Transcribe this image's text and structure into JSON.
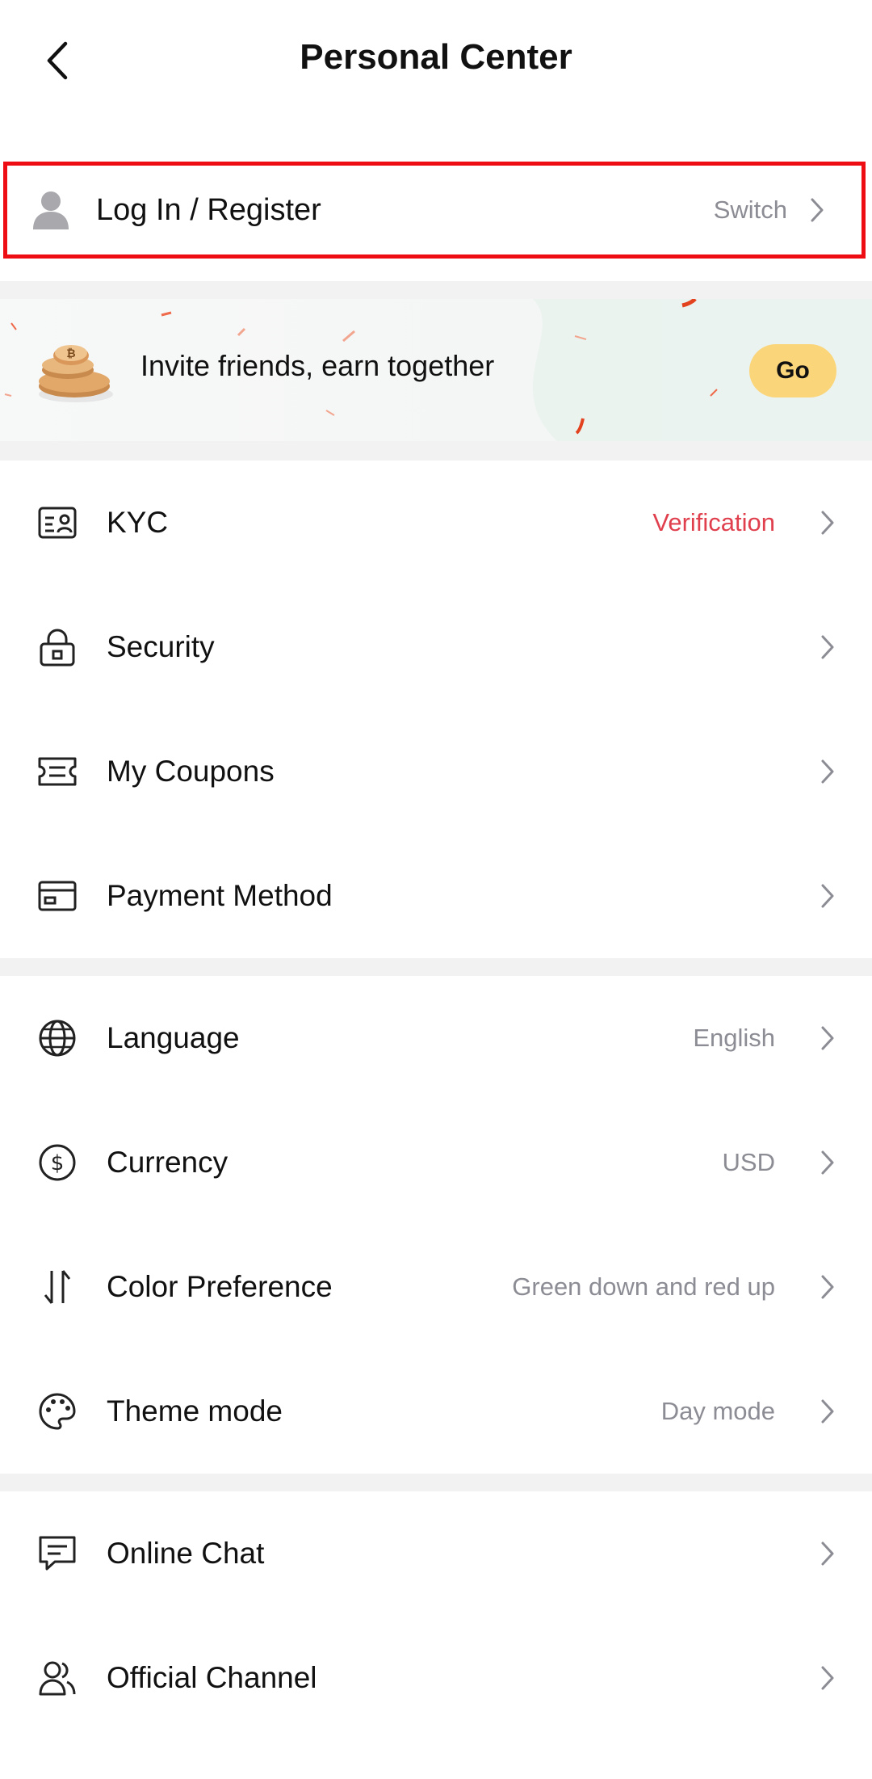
{
  "header": {
    "title": "Personal Center"
  },
  "account": {
    "login_label": "Log In / Register",
    "switch_label": "Switch"
  },
  "banner": {
    "text": "Invite friends, earn together",
    "button_label": "Go"
  },
  "menu": {
    "kyc": {
      "label": "KYC",
      "value": "Verification",
      "icon": "id-card-icon"
    },
    "security": {
      "label": "Security",
      "icon": "lock-icon"
    },
    "coupons": {
      "label": "My Coupons",
      "icon": "ticket-icon"
    },
    "payment": {
      "label": "Payment Method",
      "icon": "card-icon"
    },
    "language": {
      "label": "Language",
      "value": "English",
      "icon": "globe-icon"
    },
    "currency": {
      "label": "Currency",
      "value": "USD",
      "icon": "dollar-icon"
    },
    "color_pref": {
      "label": "Color Preference",
      "value": "Green down and red up",
      "icon": "arrows-updown-icon"
    },
    "theme": {
      "label": "Theme mode",
      "value": "Day mode",
      "icon": "palette-icon"
    },
    "chat": {
      "label": "Online Chat",
      "icon": "chat-icon"
    },
    "channel": {
      "label": "Official Channel",
      "icon": "users-icon"
    }
  },
  "colors": {
    "accent_red": "#e0404e",
    "highlight_border": "#ee0d12",
    "go_button": "#fbd57a"
  }
}
